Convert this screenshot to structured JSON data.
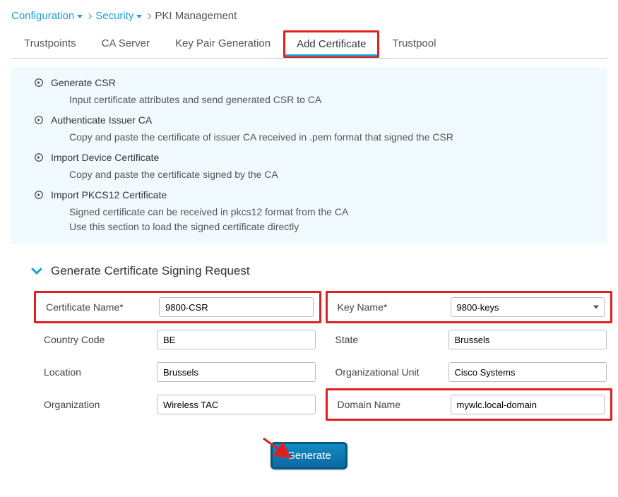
{
  "breadcrumb": {
    "configuration": "Configuration",
    "security": "Security",
    "current": "PKI Management"
  },
  "tabs": {
    "trustpoints": "Trustpoints",
    "ca_server": "CA Server",
    "key_pair": "Key Pair Generation",
    "add_cert": "Add Certificate",
    "trustpool": "Trustpool"
  },
  "info": {
    "items": [
      {
        "title": "Generate CSR",
        "desc": "Input certificate attributes and send generated CSR to CA"
      },
      {
        "title": "Authenticate Issuer CA",
        "desc": "Copy and paste the certificate of issuer CA received in .pem format that signed the CSR"
      },
      {
        "title": "Import Device Certificate",
        "desc": "Copy and paste the certificate signed by the CA"
      },
      {
        "title": "Import PKCS12 Certificate",
        "desc": "Signed certificate can be received in pkcs12 format from the CA\nUse this section to load the signed certificate directly"
      }
    ]
  },
  "section": {
    "title": "Generate Certificate Signing Request"
  },
  "form": {
    "cert_name_label": "Certificate Name*",
    "cert_name_value": "9800-CSR",
    "country_label": "Country Code",
    "country_value": "BE",
    "location_label": "Location",
    "location_value": "Brussels",
    "org_label": "Organization",
    "org_value": "Wireless TAC",
    "key_name_label": "Key Name*",
    "key_name_value": "9800-keys",
    "state_label": "State",
    "state_value": "Brussels",
    "ou_label": "Organizational Unit",
    "ou_value": "Cisco Systems",
    "domain_label": "Domain Name",
    "domain_value": "mywlc.local-domain"
  },
  "buttons": {
    "generate": "Generate"
  }
}
